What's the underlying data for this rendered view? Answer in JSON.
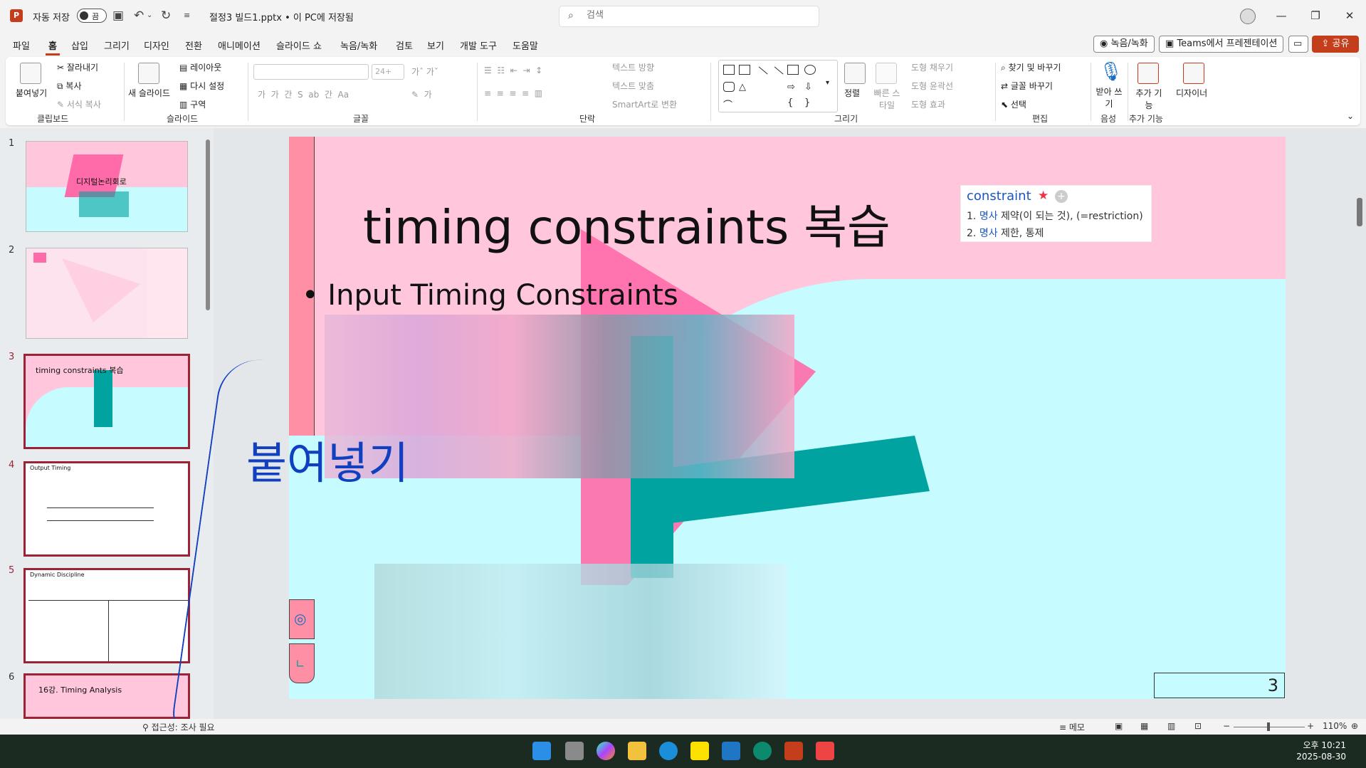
{
  "titlebar": {
    "autosave_label": "자동 저장",
    "toggle_state": "끔",
    "doc_title": "절정3 빌드1.pptx • 이 PC에 저장됨",
    "search_placeholder": "검색"
  },
  "menu": {
    "tabs": [
      "파일",
      "홈",
      "삽입",
      "그리기",
      "디자인",
      "전환",
      "애니메이션",
      "슬라이드 쇼",
      "녹음/녹화",
      "검토",
      "보기",
      "개발 도구",
      "도움말"
    ],
    "active": "홈",
    "record_btn": "녹음/녹화",
    "teams_btn": "Teams에서 프레젠테이션",
    "share_btn": "공유"
  },
  "ribbon": {
    "clipboard": {
      "paste": "붙여넣기",
      "cut": "잘라내기",
      "copy": "복사",
      "format_painter": "서식 복사",
      "label": "클립보드"
    },
    "slides": {
      "new_slide": "새 슬라이드",
      "layout": "레이아웃",
      "reset": "다시 설정",
      "section": "구역",
      "label": "슬라이드"
    },
    "font": {
      "size": "24+",
      "label": "글꼴"
    },
    "paragraph": {
      "text_direction": "텍스트 방향",
      "align_text": "텍스트 맞춤",
      "smartart": "SmartArt로 변환",
      "label": "단락"
    },
    "drawing": {
      "arrange": "정렬",
      "quick_styles": "빠른 스타일",
      "fill": "도형 채우기",
      "outline": "도형 윤곽선",
      "effects": "도형 효과",
      "label": "그리기"
    },
    "editing": {
      "find_replace": "찾기 및 바꾸기",
      "replace_font": "글꼴 바꾸기",
      "select": "선택",
      "label": "편집"
    },
    "voice": {
      "dictate": "받아 쓰기",
      "label": "음성"
    },
    "addins": {
      "addins": "추가 기능",
      "designer": "디자이너",
      "label": "추가 기능"
    }
  },
  "thumbnails": [
    {
      "num": "1",
      "text": "디지털논리회로"
    },
    {
      "num": "2",
      "text": ""
    },
    {
      "num": "3",
      "text": "timing constraints 복습"
    },
    {
      "num": "4",
      "text": "Output Timing"
    },
    {
      "num": "5",
      "text": "Dynamic Discipline"
    },
    {
      "num": "6",
      "text": "16강. Timing Analysis"
    }
  ],
  "slide": {
    "title": "timing constraints 복습",
    "handwriting_1": "• Input Timing Constraints",
    "handwriting_2": "붙여넣기",
    "page_number": "3",
    "dict": {
      "word": "constraint",
      "line1_pos": "명사",
      "line1_text": "제약(이 되는 것), (=restriction)",
      "line2_pos": "명사",
      "line2_text": "제한, 통제"
    }
  },
  "statusbar": {
    "accessibility": "접근성: 조사 필요",
    "notes": "메모",
    "zoom": "110%"
  },
  "clock": {
    "time": "오후 10:21",
    "date": "2025-08-30"
  },
  "colors": {
    "accent": "#c43e1c",
    "slide_pink": "#ffc6dc",
    "slide_cyan": "#c6fbff",
    "teal": "#00a3a0",
    "hot_pink": "#ff6aa8"
  }
}
